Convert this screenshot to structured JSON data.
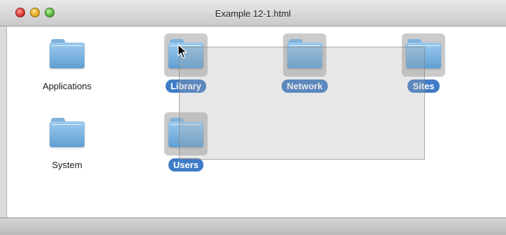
{
  "window": {
    "title": "Example 12-1.html",
    "traffic_lights": [
      "close",
      "minimize",
      "zoom"
    ]
  },
  "items": [
    {
      "label": "Applications",
      "selected": false,
      "icon": "folder-icon"
    },
    {
      "label": "Library",
      "selected": true,
      "icon": "folder-icon"
    },
    {
      "label": "Network",
      "selected": true,
      "icon": "folder-icon"
    },
    {
      "label": "Sites",
      "selected": true,
      "icon": "folder-icon"
    },
    {
      "label": "System",
      "selected": false,
      "icon": "folder-icon"
    },
    {
      "label": "Users",
      "selected": true,
      "icon": "folder-icon"
    }
  ],
  "colors": {
    "selection_label": "#3f7cc7",
    "folder": "#7fb3dc"
  }
}
